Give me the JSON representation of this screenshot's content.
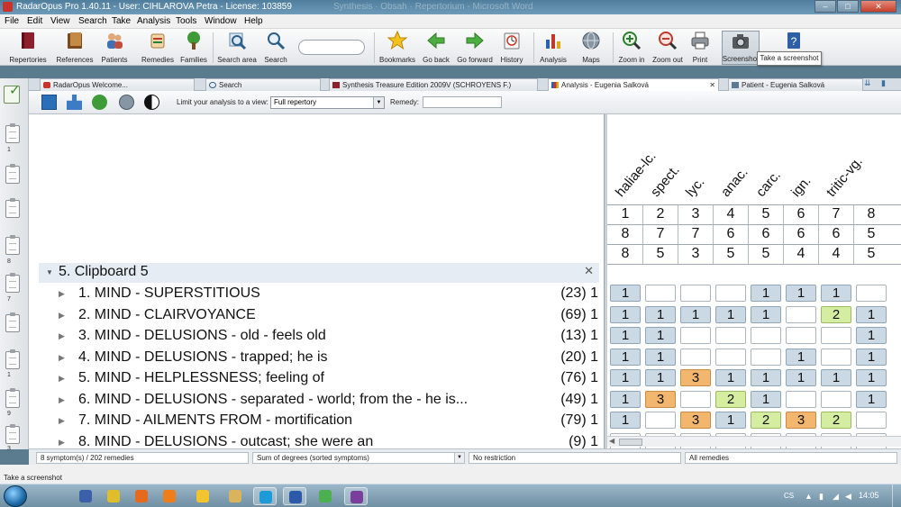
{
  "window": {
    "title": "RadarOpus Pro 1.40.11 - User: CIHLAROVA Petra - License: 103859",
    "background_title": "Synthesis · Obsah · Repertorium - Microsoft Word",
    "buttons": {
      "minimize": "–",
      "maximize": "□",
      "close": "✕"
    }
  },
  "menu": [
    "File",
    "Edit",
    "View",
    "Search",
    "Take",
    "Analysis",
    "Tools",
    "Window",
    "Help"
  ],
  "toolbar": {
    "buttons": [
      {
        "label": "Repertories",
        "icon": "repertory-book-icon"
      },
      {
        "label": "References",
        "icon": "reference-book-icon"
      },
      {
        "label": "Patients",
        "icon": "patients-icon"
      },
      {
        "label": "Remedies",
        "icon": "remedies-icon"
      },
      {
        "label": "Families",
        "icon": "families-tree-icon"
      },
      {
        "label": "Search area",
        "icon": "search-area-icon"
      },
      {
        "label": "Search",
        "icon": "search-icon"
      },
      {
        "label": "Bookmarks",
        "icon": "bookmark-star-icon"
      },
      {
        "label": "Go back",
        "icon": "arrow-left-icon"
      },
      {
        "label": "Go forward",
        "icon": "arrow-right-icon"
      },
      {
        "label": "History",
        "icon": "history-icon"
      },
      {
        "label": "Analysis",
        "icon": "analysis-chart-icon"
      },
      {
        "label": "Maps",
        "icon": "maps-globe-icon"
      },
      {
        "label": "Zoom in",
        "icon": "zoom-in-icon"
      },
      {
        "label": "Zoom out",
        "icon": "zoom-out-icon"
      },
      {
        "label": "Print",
        "icon": "printer-icon"
      },
      {
        "label": "Screenshot",
        "icon": "camera-icon"
      },
      {
        "label": "",
        "icon": "help-icon"
      }
    ],
    "search_placeholder": "",
    "tooltip": "Take a screenshot"
  },
  "tabs": [
    {
      "label": "RadarOpus Welcome...",
      "icon": "radar-icon"
    },
    {
      "label": "Search",
      "icon": "search-icon"
    },
    {
      "label": "Synthesis Treasure Edition 2009V (SCHROYENS F.)",
      "icon": "repertory-book-icon"
    },
    {
      "label": "Analysis - Eugenia Salková",
      "icon": "analysis-chart-icon",
      "active": true
    },
    {
      "label": "Patient - Eugenia Salková",
      "icon": "patient-icon"
    }
  ],
  "analysis_toolbar": {
    "limit_label": "Limit your analysis to a view:",
    "limit_value": "Full repertory",
    "remedy_label": "Remedy:",
    "remedy_value": ""
  },
  "left_strip": {
    "clip_numbers": [
      "1",
      "",
      "8",
      "7",
      "",
      "1",
      "9",
      "3"
    ]
  },
  "clipboard": {
    "title": "5. Clipboard 5",
    "close": "✕",
    "expand_glyph": "▼",
    "row_glyph": "▶",
    "symptoms": [
      {
        "text": "1. MIND - SUPERSTITIOUS",
        "count": "(23) 1"
      },
      {
        "text": "2. MIND - CLAIRVOYANCE",
        "count": "(69) 1"
      },
      {
        "text": "3. MIND - DELUSIONS - old - feels old",
        "count": "(13) 1"
      },
      {
        "text": "4. MIND - DELUSIONS - trapped; he is",
        "count": "(20) 1"
      },
      {
        "text": "5. MIND - HELPLESSNESS; feeling of",
        "count": "(76) 1"
      },
      {
        "text": "6. MIND - DELUSIONS - separated - world; from the - he is...",
        "count": "(49) 1"
      },
      {
        "text": "7. MIND - AILMENTS FROM - mortification",
        "count": "(79) 1"
      },
      {
        "text": "8. MIND - DELUSIONS - outcast; she were an",
        "count": "(9) 1"
      }
    ]
  },
  "analysis_grid": {
    "remedies": [
      "haliae-lc.",
      "spect.",
      "lyc.",
      "anac.",
      "carc.",
      "ign.",
      "tritic-vg.",
      ""
    ],
    "ranks": [
      "1",
      "2",
      "3",
      "4",
      "5",
      "6",
      "7",
      "8"
    ],
    "symptom_counts": [
      "8",
      "7",
      "7",
      "6",
      "6",
      "6",
      "6",
      "5"
    ],
    "degree_sums": [
      "8",
      "5",
      "3",
      "5",
      "5",
      "4",
      "4",
      "5"
    ],
    "cells": [
      [
        "1",
        "",
        "",
        "",
        "1",
        "1",
        "1",
        ""
      ],
      [
        "1",
        "1",
        "1",
        "1",
        "1",
        "",
        "2",
        "1"
      ],
      [
        "1",
        "1",
        "",
        "",
        "",
        "",
        "",
        "1"
      ],
      [
        "1",
        "1",
        "",
        "",
        "",
        "1",
        "",
        "1"
      ],
      [
        "1",
        "1",
        "3",
        "1",
        "1",
        "1",
        "1",
        "1"
      ],
      [
        "1",
        "3",
        "",
        "2",
        "1",
        "",
        "",
        "1"
      ],
      [
        "1",
        "",
        "3",
        "1",
        "2",
        "3",
        "2",
        ""
      ],
      [
        "",
        "",
        "",
        "",
        "",
        "",
        "",
        ""
      ]
    ],
    "scroll_arrow": "◀"
  },
  "status": {
    "summary": "8 symptom(s) / 202 remedies",
    "sort": "Sum of degrees (sorted symptoms)",
    "restriction": "No restriction",
    "remedies": "All remedies",
    "dropdown_arrow": "▼"
  },
  "app_status": "Take a screenshot",
  "taskbar": {
    "language": "CS",
    "clock": "14:05",
    "apps": [
      "media-player-icon",
      "chrome-icon",
      "firefox-icon",
      "vlc-icon",
      "smiley-icon",
      "explorer-icon",
      "skype-icon",
      "radaropus-icon",
      "chrome-alt-icon",
      "winrar-icon"
    ],
    "tray_glyphs": [
      "▲",
      "▮",
      "◢",
      "◀"
    ]
  },
  "colors": {
    "degree1": "#cad9e4",
    "degree2": "#d4eda0",
    "degree3": "#f2b66e",
    "header_band": "#e5ecf3"
  }
}
